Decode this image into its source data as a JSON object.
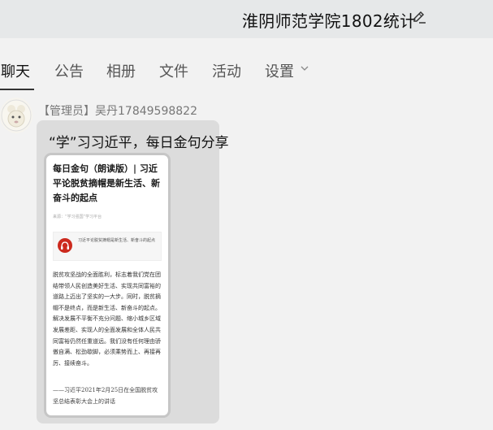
{
  "header": {
    "group_title": "淮阴师范学院1802统计"
  },
  "tabs": [
    {
      "label": "聊天",
      "active": true
    },
    {
      "label": "公告",
      "active": false
    },
    {
      "label": "相册",
      "active": false
    },
    {
      "label": "文件",
      "active": false
    },
    {
      "label": "活动",
      "active": false
    },
    {
      "label": "设置",
      "active": false
    }
  ],
  "message": {
    "sender": "【管理员】吴丹17849598822",
    "text": "“学”习习近平，每日金句分享",
    "card": {
      "title": "每日金句（朗读版）| 习近平论脱贫摘帽是新生活、新奋斗的起点",
      "source": "来源：“学习强国”学习平台",
      "audio_caption": "习近平论脱贫摘帽是新生活、新奋斗的起点",
      "body": "脱贫攻坚战的全面胜利，标志着我们党在团结带领人民创造美好生活、实现共同富裕的道路上迈出了坚实的一大步。同时，脱贫摘帽不是终点，而是新生活、新奋斗的起点。解决发展不平衡不充分问题、缩小城乡区域发展差距、实现人的全面发展和全体人民共同富裕仍然任重道远。我们没有任何理由骄傲自满、松劲歇脚，必须乘势而上、再接再厉、接续奋斗。",
      "quote": "——习近平2021年2月25日在全国脱贫攻坚总结表彰大会上的讲话"
    }
  },
  "colors": {
    "header_bg": "#e6e8e9",
    "page_bg": "#f2f2f2",
    "bubble_bg": "#dcdcdc",
    "audio_red": "#cc2a1e"
  },
  "icons": {
    "edit": "pencil-icon",
    "settings_dropdown": "chevron-down-icon",
    "audio": "headphones-icon"
  }
}
